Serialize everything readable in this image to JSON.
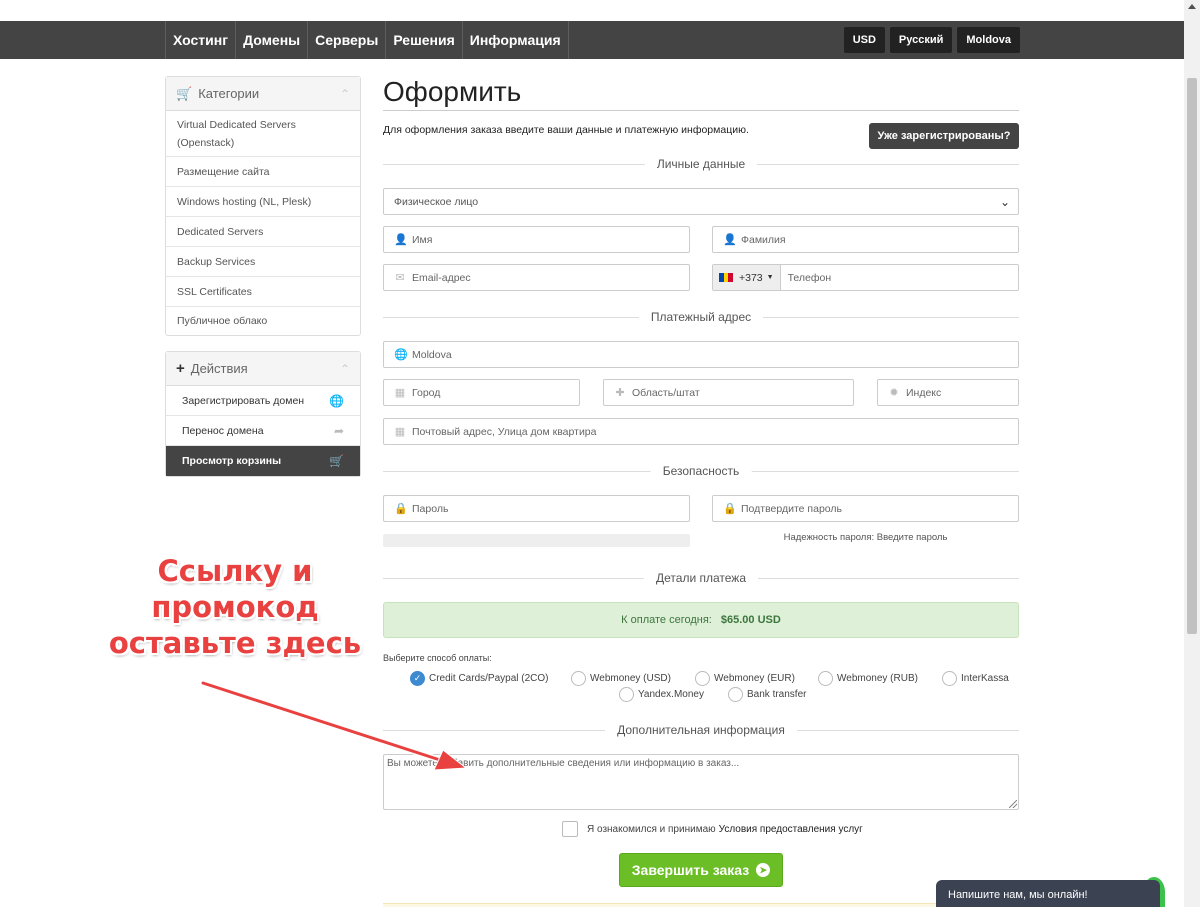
{
  "nav": {
    "items": [
      "Хостинг",
      "Домены",
      "Серверы",
      "Решения",
      "Информация"
    ],
    "currency": "USD",
    "language": "Русский",
    "country": "Moldova"
  },
  "sidebar": {
    "categories_title": "Категории",
    "categories": [
      "Virtual Dedicated Servers (Openstack)",
      "Размещение сайта",
      "Windows hosting (NL, Plesk)",
      "Dedicated Servers",
      "Backup Services",
      "SSL Certificates",
      "Публичное облако"
    ],
    "actions_title": "Действия",
    "actions": [
      {
        "label": "Зарегистрировать домен",
        "icon": "globe-icon"
      },
      {
        "label": "Перенос домена",
        "icon": "share-arrow-icon"
      },
      {
        "label": "Просмотр корзины",
        "icon": "cart-icon"
      }
    ]
  },
  "main": {
    "title": "Оформить",
    "intro": "Для оформления заказа введите ваши данные и платежную информацию.",
    "already_registered": "Уже зарегистрированы?",
    "sections": {
      "personal": "Личные данные",
      "billing": "Платежный адрес",
      "security": "Безопасность",
      "payment": "Детали платежа",
      "additional": "Дополнительная информация"
    },
    "account_type": "Физическое лицо",
    "placeholders": {
      "first_name": "Имя",
      "last_name": "Фамилия",
      "email": "Email-адрес",
      "phone_code": "+373",
      "phone": "Телефон",
      "country": "Moldova",
      "city": "Город",
      "state": "Область/штат",
      "zip": "Индекс",
      "address": "Почтовый адрес, Улица дом квартира",
      "password": "Пароль",
      "password_confirm": "Подтвердите пароль",
      "notes": "Вы можете добавить дополнительные сведения или информацию в заказ..."
    },
    "password_strength": "Надежность пароля: Введите пароль",
    "due_today_label": "К оплате сегодня:",
    "due_today_amount": "$65.00 USD",
    "payment_label": "Выберите способ оплаты:",
    "payment_methods": [
      "Credit Cards/Paypal (2CO)",
      "Webmoney (USD)",
      "Webmoney (EUR)",
      "Webmoney (RUB)",
      "InterKassa",
      "Yandex.Money",
      "Bank transfer"
    ],
    "selected_payment": "Credit Cards/Paypal (2CO)",
    "tos_text": "Я ознакомился и принимаю",
    "tos_link": "Условия предоставления услуг",
    "complete_button": "Завершить заказ"
  },
  "chat": {
    "label": "Напишите нам, мы онлайн!"
  },
  "annotation": {
    "lines": [
      "Ссылку и",
      "промокод",
      "оставьте здесь"
    ],
    "color": "#e8413f"
  }
}
